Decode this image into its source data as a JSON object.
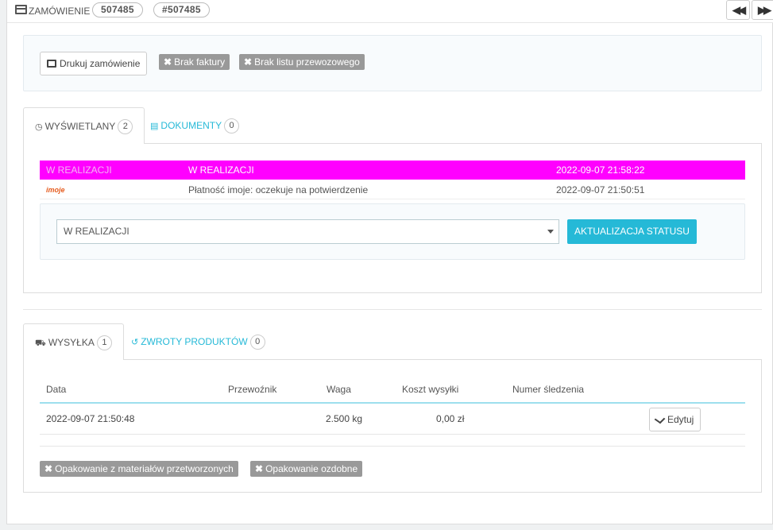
{
  "header": {
    "title": "ZAMÓWIENIE",
    "order_id": "507485",
    "order_ref": "#507485",
    "prev_icon": "backward-icon",
    "next_icon": "forward-icon"
  },
  "toolbar": {
    "print_label": "Drukuj zamówienie",
    "no_invoice_label": "Brak faktury",
    "no_delivery_slip_label": "Brak listu przewozowego"
  },
  "history_tabs": [
    {
      "label": "WYŚWIETLANY",
      "count": "2",
      "icon": "clock-icon"
    },
    {
      "label": "DOKUMENTY",
      "count": "0",
      "icon": "file-icon"
    }
  ],
  "history": [
    {
      "icon_alt": "W REALIZACJI",
      "status": "W REALIZACJI",
      "date": "2022-09-07 21:58:22",
      "highlight_color": "#ff00ff"
    },
    {
      "icon_alt": "imoje",
      "status": "Płatność imoje: oczekuje na potwierdzenie",
      "date": "2022-09-07 21:50:51"
    }
  ],
  "status_form": {
    "selected": "W REALIZACJI",
    "update_label": "AKTUALIZACJA STATUSU"
  },
  "shipping_tabs": [
    {
      "label": "WYSYŁKA",
      "count": "1",
      "icon": "truck-icon"
    },
    {
      "label": "ZWROTY PRODUKTÓW",
      "count": "0",
      "icon": "undo-icon"
    }
  ],
  "shipping_table": {
    "headers": [
      "Data",
      "Przewoźnik",
      "Waga",
      "Koszt wysyłki",
      "Numer śledzenia"
    ],
    "rows": [
      {
        "date": "2022-09-07 21:50:48",
        "carrier": "",
        "weight": "2.500 kg",
        "cost": "0,00 zł",
        "tracking": "",
        "edit_label": "Edytuj"
      }
    ]
  },
  "extras": {
    "recycled_label": "Opakowanie z materiałów przetworzonych",
    "gift_label": "Opakowanie ozdobne"
  },
  "colors": {
    "accent": "#25b9d7",
    "highlight": "#ff00ff",
    "tag": "#999999"
  }
}
